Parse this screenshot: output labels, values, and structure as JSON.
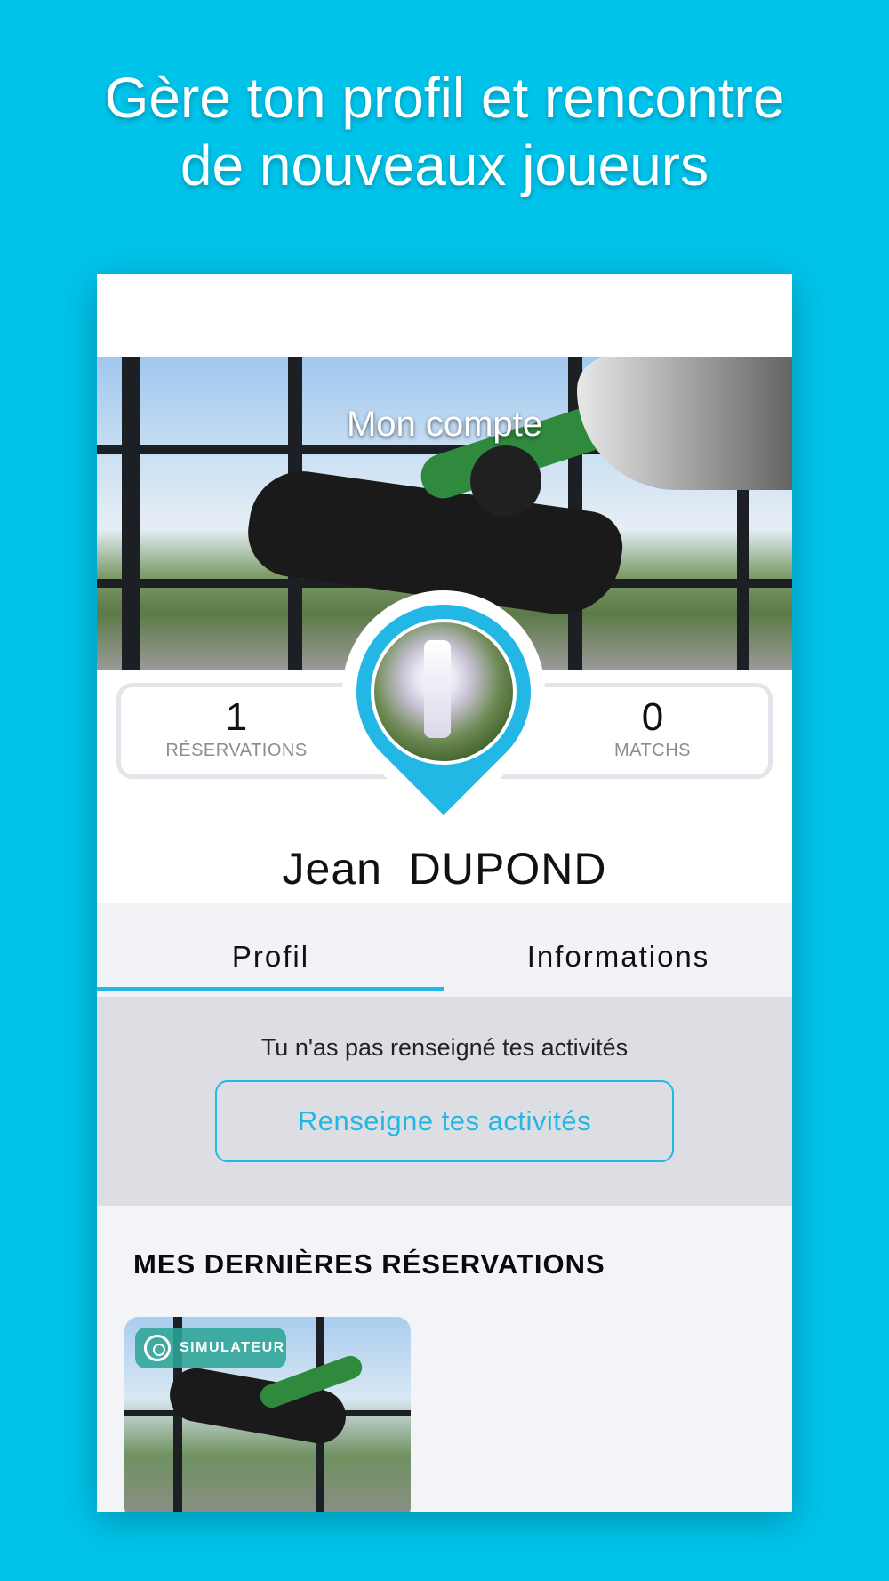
{
  "headline": {
    "line1": "Gère ton profil et rencontre",
    "line2": "de nouveaux joueurs"
  },
  "profile": {
    "cover_title": "Mon compte",
    "first_name": "Jean",
    "last_name": "DUPOND",
    "stats": {
      "reservations_value": "1",
      "reservations_label": "RÉSERVATIONS",
      "matchs_value": "0",
      "matchs_label": "MATCHS"
    }
  },
  "tabs": [
    {
      "label": "Profil",
      "active": true
    },
    {
      "label": "Informations",
      "active": false
    }
  ],
  "activity": {
    "message": "Tu n'as pas renseigné tes activités",
    "button_label": "Renseigne tes activités"
  },
  "reservations": {
    "title": "MES DERNIÈRES RÉSERVATIONS",
    "cards": [
      {
        "badge": "SIMULATEUR",
        "badge_icon": "compass-icon"
      }
    ]
  },
  "colors": {
    "background": "#00c3ea",
    "accent": "#22b7e5",
    "badge": "#2da596"
  }
}
